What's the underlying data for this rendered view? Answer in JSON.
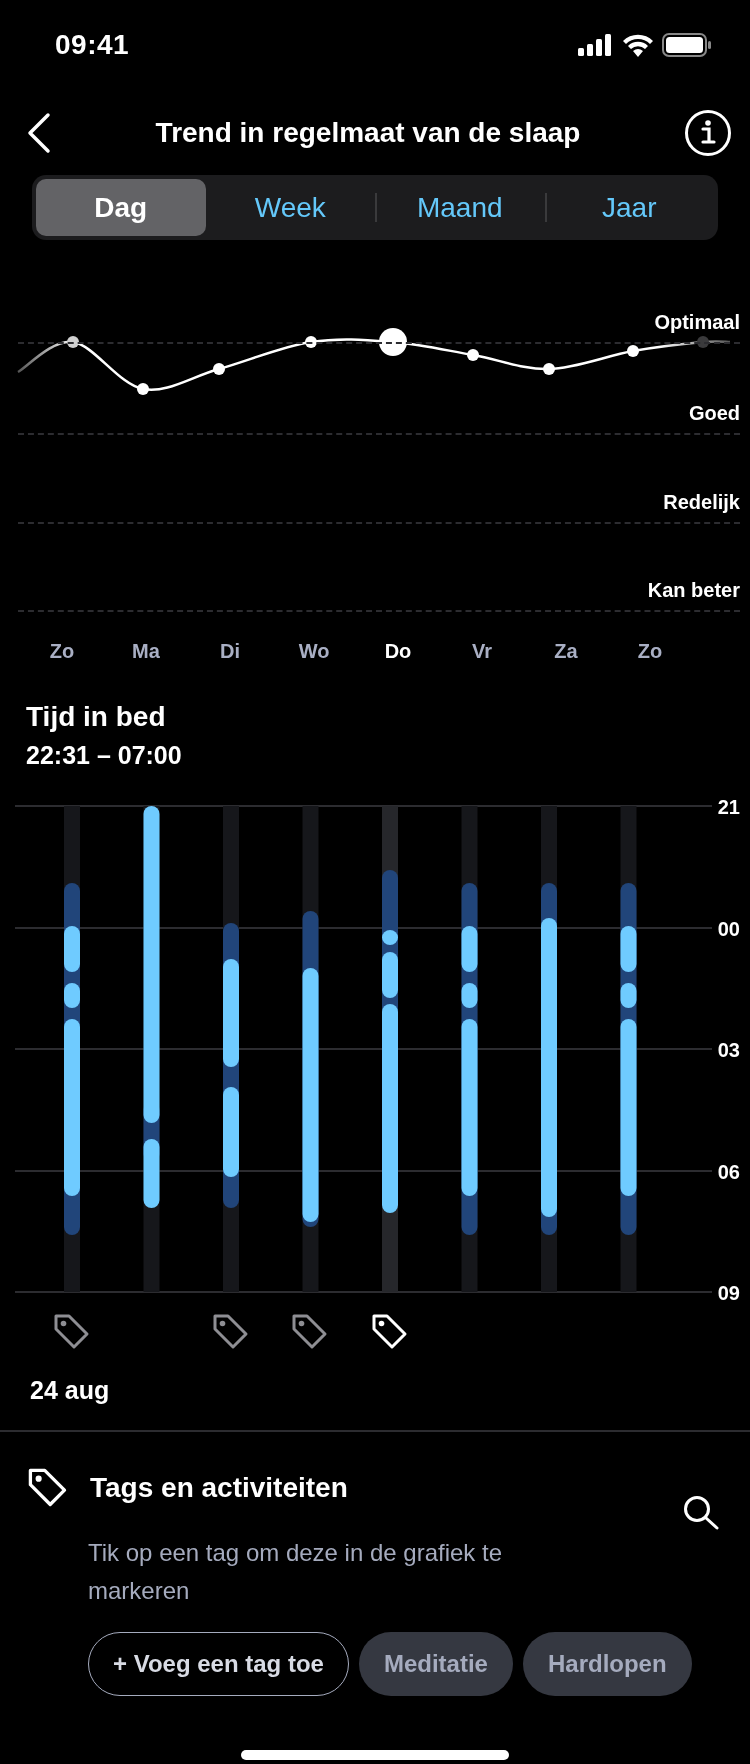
{
  "status_bar": {
    "time": "09:41"
  },
  "header": {
    "title": "Trend in regelmaat van de slaap"
  },
  "period_tabs": [
    {
      "label": "Dag",
      "selected": true
    },
    {
      "label": "Week",
      "selected": false
    },
    {
      "label": "Maand",
      "selected": false
    },
    {
      "label": "Jaar",
      "selected": false
    }
  ],
  "trend_chart": {
    "levels": [
      "Optimaal",
      "Goed",
      "Redelijk",
      "Kan beter"
    ],
    "days": [
      {
        "label": "Zo",
        "selected": false
      },
      {
        "label": "Ma",
        "selected": false
      },
      {
        "label": "Di",
        "selected": false
      },
      {
        "label": "Wo",
        "selected": false
      },
      {
        "label": "Do",
        "selected": true
      },
      {
        "label": "Vr",
        "selected": false
      },
      {
        "label": "Za",
        "selected": false
      },
      {
        "label": "Zo",
        "selected": false
      }
    ]
  },
  "time_in_bed": {
    "title": "Tijd in bed",
    "range": "22:31 – 07:00",
    "hour_ticks": [
      "21",
      "00",
      "03",
      "06",
      "09"
    ],
    "days": [
      {
        "tagged": true,
        "selected": false
      },
      {
        "tagged": false,
        "selected": false
      },
      {
        "tagged": true,
        "selected": false
      },
      {
        "tagged": true,
        "selected": false
      },
      {
        "tagged": true,
        "selected": true
      },
      {
        "tagged": false,
        "selected": false
      },
      {
        "tagged": false,
        "selected": false
      },
      {
        "tagged": false,
        "selected": false
      }
    ],
    "date": "24 aug"
  },
  "tags_panel": {
    "title": "Tags en activiteiten",
    "description": "Tik op een tag om deze in de grafiek te markeren",
    "chips": [
      {
        "kind": "add",
        "label": "+ Voeg een tag toe"
      },
      {
        "kind": "tag",
        "label": "Meditatie"
      },
      {
        "kind": "tag",
        "label": "Hardlopen"
      }
    ]
  }
}
